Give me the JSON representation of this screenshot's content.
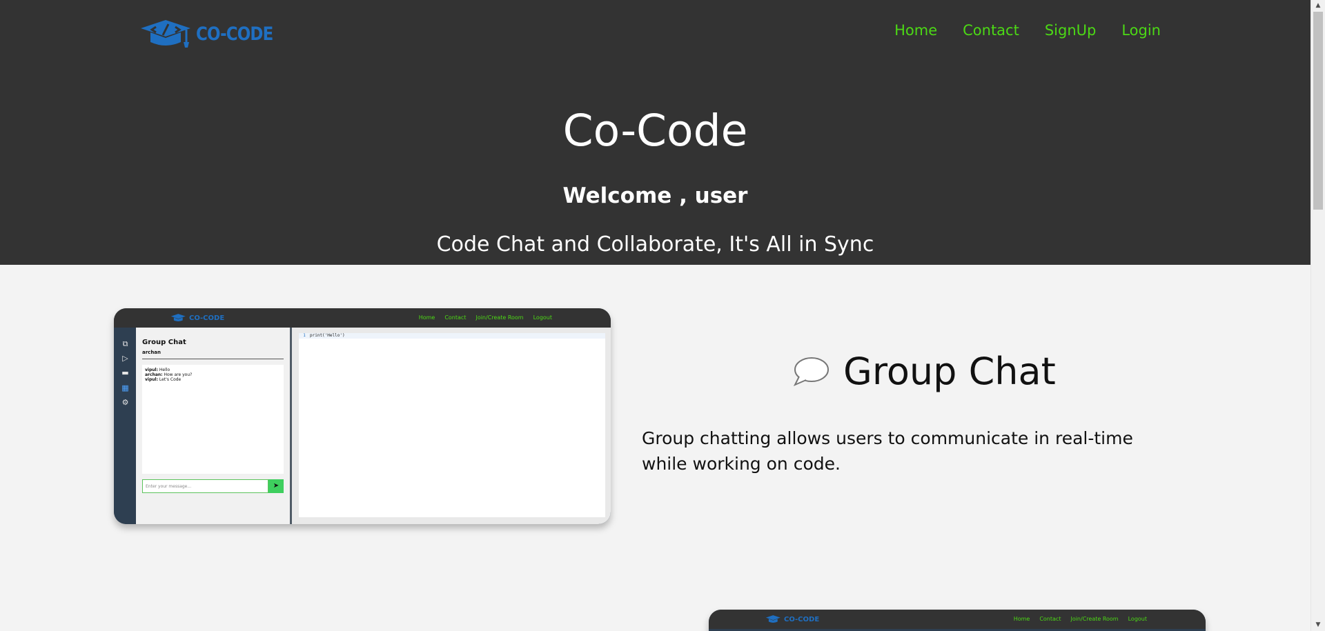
{
  "header": {
    "logo_text": "CO-CODE",
    "logo_icon": "graduation-cap-code-icon",
    "nav": [
      "Home",
      "Contact",
      "SignUp",
      "Login"
    ]
  },
  "hero": {
    "title": "Co-Code",
    "welcome": "Welcome , user",
    "tagline": "Code Chat and Collaborate, It's All in Sync"
  },
  "feature": {
    "icon": "speech-bubble-icon",
    "title": "Group Chat",
    "description": "Group chatting allows users to communicate in real-time while working on code."
  },
  "preview": {
    "logo_text": "CO-CODE",
    "nav": [
      "Home",
      "Contact",
      "Join/Create Room",
      "Logout"
    ],
    "sidebar_icons": [
      "copy-icon",
      "run-icon",
      "chat-icon",
      "users-icon",
      "settings-icon"
    ],
    "chat_title": "Group Chat",
    "chat_user": "archan",
    "messages": [
      {
        "user": "vipul:",
        "text": "Hello"
      },
      {
        "user": "archan:",
        "text": "How are you?"
      },
      {
        "user": "vipul:",
        "text": "Let's Code"
      }
    ],
    "input_placeholder": "Enter your message...",
    "code_line_number": "1",
    "code_text": "print('Hello')"
  },
  "colors": {
    "header_bg": "#333333",
    "nav_link": "#4cd915",
    "brand_blue": "#1f6fc1",
    "page_bg": "#f3f3f3"
  }
}
